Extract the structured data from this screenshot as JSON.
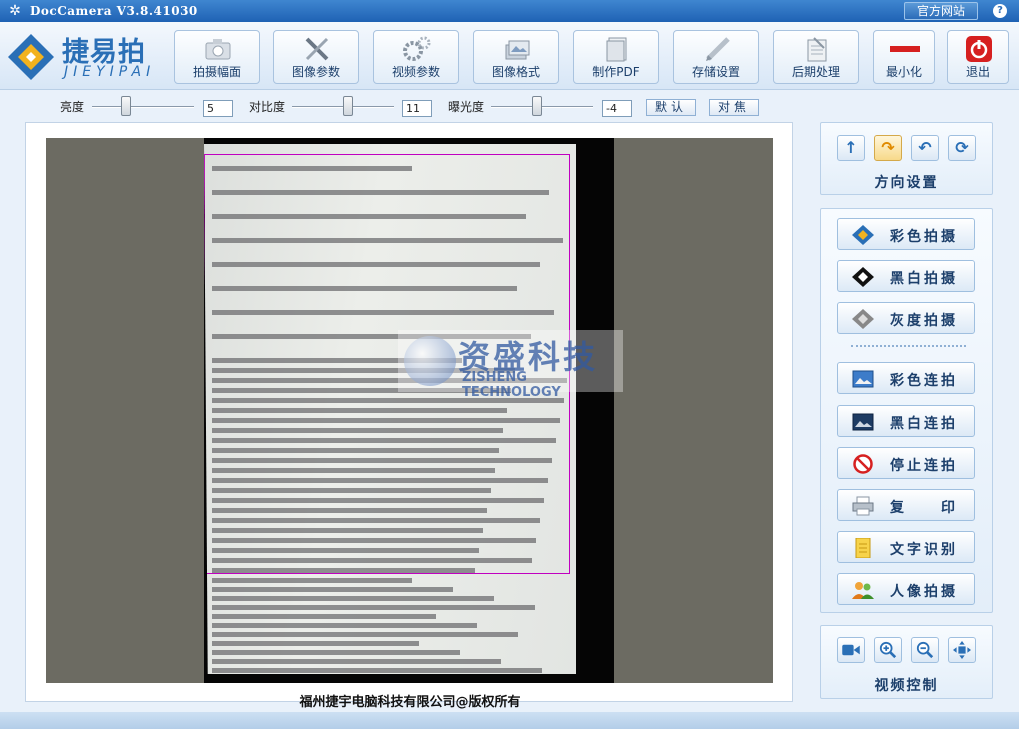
{
  "window": {
    "title": "DocCamera V3.8.41030",
    "official_site": "官方网站",
    "help": "?"
  },
  "logo": {
    "cn": "捷易拍",
    "en": "JIEYIPAI"
  },
  "toolbar": [
    {
      "key": "capture-size",
      "label": "拍摄幅面",
      "icon": "camera-icon"
    },
    {
      "key": "image-params",
      "label": "图像参数",
      "icon": "tools-icon"
    },
    {
      "key": "video-params",
      "label": "视频参数",
      "icon": "gears-icon"
    },
    {
      "key": "image-format",
      "label": "图像格式",
      "icon": "image-stack-icon"
    },
    {
      "key": "make-pdf",
      "label": "制作PDF",
      "icon": "document-icon"
    },
    {
      "key": "storage-settings",
      "label": "存储设置",
      "icon": "pen-icon"
    },
    {
      "key": "post-processing",
      "label": "后期处理",
      "icon": "notepad-icon"
    },
    {
      "key": "minimize",
      "label": "最小化",
      "icon": "minimize-icon"
    },
    {
      "key": "exit",
      "label": "退出",
      "icon": "power-icon"
    }
  ],
  "adjust": {
    "brightness": {
      "label": "亮度",
      "value": "5",
      "level": 0.33
    },
    "contrast": {
      "label": "对比度",
      "value": "11",
      "level": 0.55
    },
    "exposure": {
      "label": "曝光度",
      "value": "-4",
      "level": 0.45
    },
    "default_btn": "默认",
    "focus_btn": "对焦"
  },
  "watermark": {
    "cn": "资盛科技",
    "en": "ZISHENG TECHNOLOGY"
  },
  "copyright": "福州捷宇电脑科技有限公司@版权所有",
  "direction": {
    "title": "方向设置",
    "buttons": [
      "↑",
      "↷",
      "↶",
      "⟳"
    ]
  },
  "capture": [
    {
      "key": "color-capture",
      "label": "彩色拍摄",
      "icon": "color-diamond-icon"
    },
    {
      "key": "bw-capture",
      "label": "黑白拍摄",
      "icon": "bw-diamond-icon"
    },
    {
      "key": "gray-capture",
      "label": "灰度拍摄",
      "icon": "gray-diamond-icon"
    }
  ],
  "continuous": [
    {
      "key": "color-continuous",
      "label": "彩色连拍",
      "icon": "color-photo-icon"
    },
    {
      "key": "bw-continuous",
      "label": "黑白连拍",
      "icon": "bw-photo-icon"
    },
    {
      "key": "stop-continuous",
      "label": "停止连拍",
      "icon": "stop-icon"
    },
    {
      "key": "copy",
      "label": "复　　印",
      "icon": "printer-icon"
    },
    {
      "key": "ocr",
      "label": "文字识别",
      "icon": "text-doc-icon"
    },
    {
      "key": "portrait",
      "label": "人像拍摄",
      "icon": "people-icon"
    }
  ],
  "video": {
    "title": "视频控制"
  },
  "colors": {
    "accent": "#2a6fb6",
    "selection": "#c000c0"
  }
}
